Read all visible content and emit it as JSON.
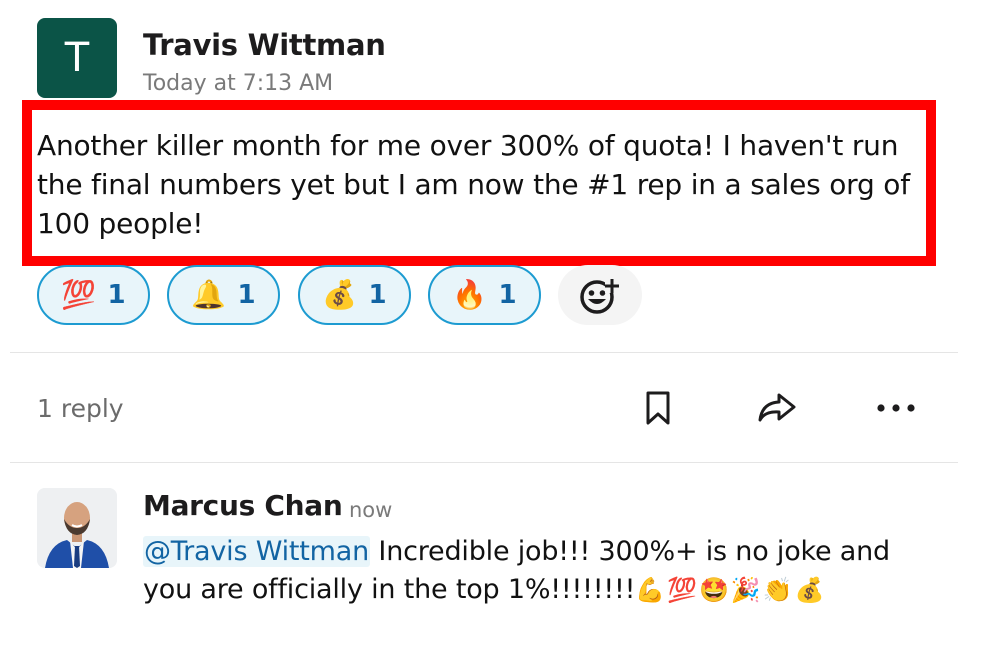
{
  "message": {
    "avatar_initial": "T",
    "author": "Travis Wittman",
    "timestamp": "Today at 7:13 AM",
    "text": "Another killer month for me over 300% of quota! I haven't run the final numbers yet but I am now the #1 rep in a sales org of 100 people!",
    "highlight_color": "#ff0000",
    "avatar_color": "#0b5447"
  },
  "reactions": [
    {
      "emoji": "💯",
      "icon": "hundred-points-emoji",
      "count": "1"
    },
    {
      "emoji": "🔔",
      "icon": "bell-emoji",
      "count": "1"
    },
    {
      "emoji": "💰",
      "icon": "money-bag-emoji",
      "count": "1"
    },
    {
      "emoji": "🔥",
      "icon": "fire-emoji",
      "count": "1"
    }
  ],
  "thread": {
    "reply_count": "1 reply",
    "actions": [
      "bookmark-icon",
      "share-icon",
      "more-icon"
    ]
  },
  "reply": {
    "author": "Marcus Chan",
    "time": "now",
    "mention": "@Travis Wittman",
    "text": " Incredible job!!! 300%+ is no joke and you are officially in the top 1%!!!!!!!!",
    "emojis": "💪💯🤩🎉👏💰"
  },
  "colors": {
    "accent": "#1d9bd1",
    "mention_text": "#1264a3",
    "reaction_bg": "#e8f5fa"
  }
}
